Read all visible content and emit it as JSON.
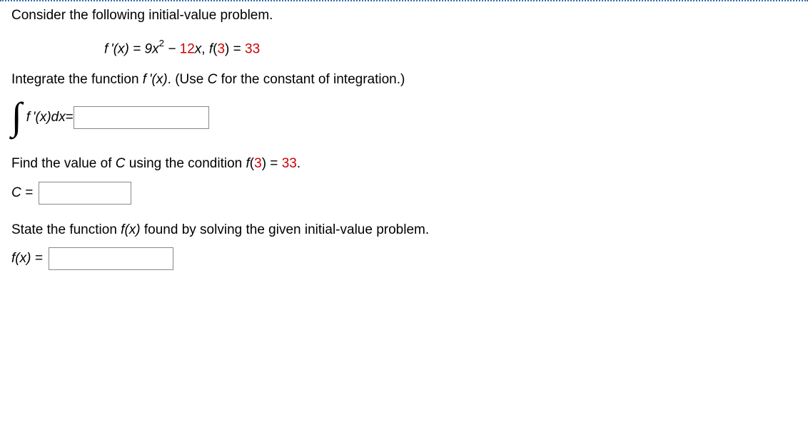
{
  "intro": "Consider the following initial-value problem.",
  "equation": {
    "lhs": "f '(x) = 9x",
    "exp": "2",
    "mid": " − 12x, f(",
    "cond_x": "3",
    "mid2": ") = ",
    "cond_val": "33"
  },
  "integrate_instruction": {
    "prefix": "Integrate the function ",
    "func": "f '(x)",
    "suffix1": ". (Use ",
    "C": "C",
    "suffix2": " for the constant of integration.)"
  },
  "integral": {
    "integrand": "f '(x)dx",
    "equals": " = "
  },
  "findC": {
    "prefix": "Find the value of ",
    "C": "C",
    "mid": " using the condition ",
    "func": "f",
    "open": "(",
    "cond_x": "3",
    "close": ") = ",
    "cond_val": "33",
    "end": "."
  },
  "Clabel": "C = ",
  "state_instruction": {
    "prefix": "State the function ",
    "func": "f(x)",
    "suffix": " found by solving the given initial-value problem."
  },
  "fxlabel": "f(x) = "
}
